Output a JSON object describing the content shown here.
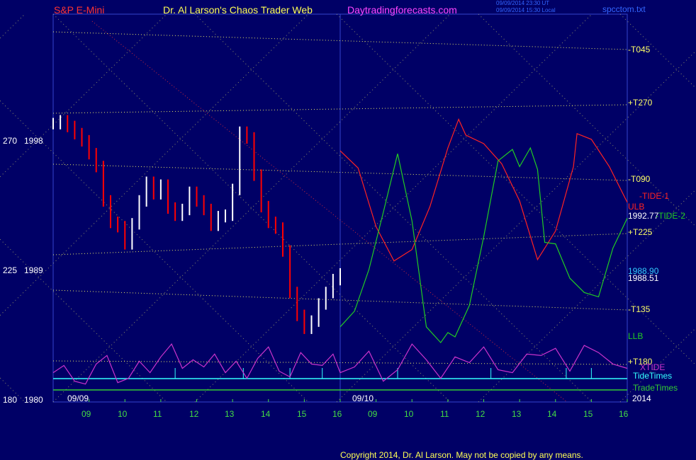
{
  "header": {
    "symbol": "S&P E-Mini",
    "publisher": "Dr. Al Larson's Chaos Trader Web",
    "site": "Daytradingforecasts.com",
    "timestamp_1": "09/09/2014 23:30 UT",
    "timestamp_2": "09/09/2014 15:30 Local",
    "file": "spcctom.txt"
  },
  "footer": {
    "copyright": "Copyright 2014, Dr. Al Larson. May not be copied by any means."
  },
  "colors": {
    "background": "#000066",
    "price_up": "#ffffff",
    "price_down": "#ff0000",
    "xtide": "#cc33cc",
    "tide1": "#ff2222",
    "tide2": "#22cc22",
    "tidetimes": "#33ffff",
    "tradetimes": "#33cc33",
    "grid_dot": "#ffff66",
    "x_tick": "#44dd44"
  },
  "chart_data": {
    "type": "line",
    "x": {
      "start_date_label": "09/09",
      "forecast_date_label": "09/10",
      "year_label": "2014",
      "ticks": [
        "09",
        "10",
        "11",
        "12",
        "13",
        "14",
        "15",
        "16",
        "09",
        "10",
        "11",
        "12",
        "13",
        "14",
        "15",
        "16"
      ]
    },
    "y_axis_left": {
      "labels": [
        {
          "angle": "270",
          "price": "1998"
        },
        {
          "angle": "225",
          "price": "1989"
        },
        {
          "angle": "180",
          "price": "1980"
        }
      ],
      "ylim": [
        1980,
        2001
      ]
    },
    "right_labels": [
      {
        "text": "-T045",
        "color": "#ffff66"
      },
      {
        "text": "+T270",
        "color": "#ffff66"
      },
      {
        "text": "-T090",
        "color": "#ffff66"
      },
      {
        "text": "-TIDE-1",
        "color": "#ff2222"
      },
      {
        "text": "ULB",
        "color": "#ff2222"
      },
      {
        "text": "1992.77",
        "color": "#ffffff"
      },
      {
        "text": "-TIDE-2",
        "color": "#22cc22"
      },
      {
        "text": "+T225",
        "color": "#ffff66"
      },
      {
        "text": "1988.90",
        "color": "#33ccff"
      },
      {
        "text": "1988.51",
        "color": "#ffffff"
      },
      {
        "text": "-T135",
        "color": "#ffff66"
      },
      {
        "text": "LLB",
        "color": "#22cc22"
      },
      {
        "text": "+T180",
        "color": "#ffff66"
      },
      {
        "text": "XTIDE",
        "color": "#cc33cc"
      },
      {
        "text": "TideTimes",
        "color": "#33ffff"
      },
      {
        "text": "TradeTimes",
        "color": "#33cc33"
      }
    ],
    "price_bars": {
      "hours": [
        8.0,
        8.2,
        8.4,
        8.6,
        8.8,
        9.0,
        9.2,
        9.4,
        9.6,
        9.8,
        10.0,
        10.2,
        10.4,
        10.6,
        10.8,
        11.0,
        11.2,
        11.4,
        11.6,
        11.8,
        12.0,
        12.2,
        12.4,
        12.6,
        12.8,
        13.0,
        13.2,
        13.4,
        13.6,
        13.8,
        14.0,
        14.2,
        14.4,
        14.6,
        14.8,
        15.0,
        15.2,
        15.4,
        15.6,
        15.8,
        16.0
      ],
      "close": [
        1999.4,
        1999.6,
        1999.2,
        1998.7,
        1998.2,
        1997.3,
        1996.4,
        1994.0,
        1992.5,
        1992.2,
        1991.0,
        1992.4,
        1994.0,
        1995.3,
        1994.5,
        1995.1,
        1993.5,
        1993.0,
        1993.4,
        1994.6,
        1994.0,
        1993.4,
        1992.3,
        1992.9,
        1993.0,
        1994.8,
        1998.8,
        1998.4,
        1995.8,
        1993.6,
        1992.5,
        1992.1,
        1990.5,
        1987.6,
        1986.0,
        1985.1,
        1985.6,
        1986.8,
        1987.6,
        1988.5,
        1988.9
      ]
    },
    "series": [
      {
        "name": "XTIDE",
        "color": "#cc33cc",
        "x": [
          8.0,
          8.3,
          8.6,
          8.9,
          9.2,
          9.5,
          9.8,
          10.1,
          10.4,
          10.7,
          11.0,
          11.3,
          11.6,
          11.9,
          12.2,
          12.5,
          12.8,
          13.1,
          13.4,
          13.7,
          14.0,
          14.3,
          14.6,
          14.9,
          15.2,
          15.5,
          15.8,
          16.0,
          16.4,
          16.8,
          17.2,
          17.6,
          18.0,
          18.4,
          18.8,
          19.2,
          19.6,
          20.0,
          20.4,
          20.8,
          21.2,
          21.6,
          22.0,
          22.4,
          22.8,
          23.2,
          23.6,
          24.0
        ],
        "y": [
          1982.0,
          1982.5,
          1981.4,
          1981.2,
          1982.6,
          1983.2,
          1981.3,
          1981.6,
          1982.8,
          1982.0,
          1983.1,
          1984.0,
          1982.3,
          1982.9,
          1982.4,
          1983.3,
          1982.0,
          1982.8,
          1981.6,
          1983.0,
          1983.8,
          1982.1,
          1981.7,
          1983.4,
          1982.6,
          1982.5,
          1983.3,
          1982.0,
          1982.4,
          1983.5,
          1981.4,
          1982.2,
          1984.0,
          1982.9,
          1981.6,
          1983.1,
          1982.7,
          1983.8,
          1982.2,
          1982.0,
          1983.3,
          1983.2,
          1983.7,
          1982.1,
          1983.9,
          1983.4,
          1982.6,
          1982.3
        ]
      },
      {
        "name": "-TIDE-1",
        "color": "#ff2222",
        "x": [
          16.0,
          16.5,
          17.0,
          17.5,
          18.0,
          18.5,
          19.0,
          19.3,
          19.5,
          20.0,
          20.5,
          21.0,
          21.5,
          22.0,
          22.5,
          22.6,
          23.0,
          23.5,
          24.0
        ],
        "y": [
          1997.5,
          1996.3,
          1992.2,
          1989.8,
          1990.6,
          1993.6,
          1997.7,
          1999.7,
          1998.6,
          1998.0,
          1996.6,
          1994.0,
          1989.9,
          1991.9,
          1996.4,
          1998.7,
          1998.3,
          1996.4,
          1993.9
        ]
      },
      {
        "name": "-TIDE-2",
        "color": "#22cc22",
        "x": [
          16.0,
          16.4,
          16.8,
          17.2,
          17.6,
          18.0,
          18.4,
          18.8,
          19.0,
          19.2,
          19.6,
          20.0,
          20.4,
          20.8,
          21.0,
          21.3,
          21.5,
          21.7,
          22.0,
          22.4,
          22.8,
          23.2,
          23.6,
          24.0
        ],
        "y": [
          1985.2,
          1986.3,
          1989.2,
          1993.2,
          1997.3,
          1992.6,
          1985.2,
          1984.1,
          1984.8,
          1984.5,
          1986.7,
          1991.5,
          1996.8,
          1997.6,
          1996.4,
          1997.7,
          1996.2,
          1991.1,
          1991.0,
          1988.6,
          1987.6,
          1987.3,
          1990.7,
          1992.8
        ]
      }
    ]
  }
}
